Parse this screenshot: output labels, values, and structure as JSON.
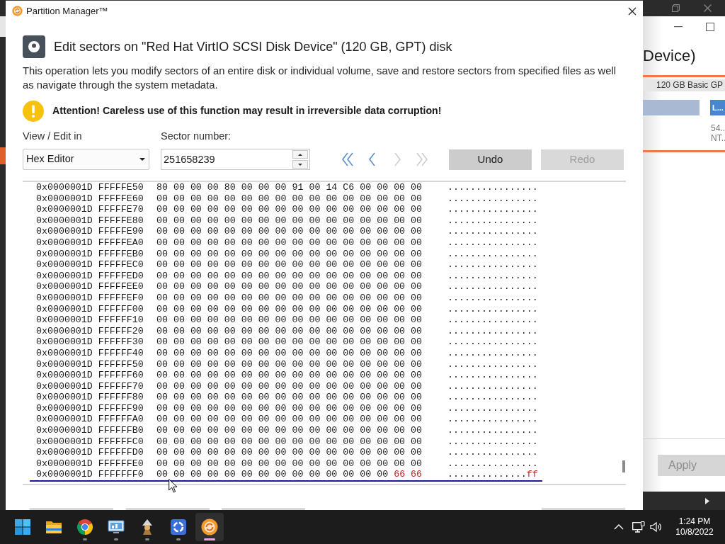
{
  "dialog": {
    "title": "Partition Manager™",
    "heading": "Edit sectors on \"Red Hat VirtIO SCSI Disk Device\" (120 GB, GPT) disk",
    "description": "This operation lets you modify sectors of an entire disk or individual volume, save and restore sectors from specified files as well as navigate through the system metadata.",
    "warning": "Attention! Careless use of this function may result in irreversible data corruption!"
  },
  "view_edit": {
    "label": "View / Edit in",
    "value": "Hex Editor"
  },
  "sector": {
    "label": "Sector number:",
    "value": "251658239"
  },
  "nav_buttons": [
    {
      "kind": "first",
      "disabled": false
    },
    {
      "kind": "previous",
      "disabled": false
    },
    {
      "kind": "next",
      "disabled": true
    },
    {
      "kind": "last",
      "disabled": true
    }
  ],
  "buttons": [
    {
      "label": "Undo",
      "disabled": false
    },
    {
      "label": "Redo",
      "disabled": true
    }
  ],
  "hex_view": {
    "rows": [
      {
        "offset": "0x0000001D FFFFFE50",
        "bytes": [
          "80",
          "00",
          "00",
          "00",
          "80",
          "00",
          "00",
          "00",
          "91",
          "00",
          "14",
          "C6",
          "00",
          "00",
          "00",
          "00"
        ],
        "ascii": "................",
        "editing": false
      },
      {
        "offset": "0x0000001D FFFFFE60",
        "bytes": [
          "00",
          "00",
          "00",
          "00",
          "00",
          "00",
          "00",
          "00",
          "00",
          "00",
          "00",
          "00",
          "00",
          "00",
          "00",
          "00"
        ],
        "ascii": "................",
        "editing": false
      },
      {
        "offset": "0x0000001D FFFFFE70",
        "bytes": [
          "00",
          "00",
          "00",
          "00",
          "00",
          "00",
          "00",
          "00",
          "00",
          "00",
          "00",
          "00",
          "00",
          "00",
          "00",
          "00"
        ],
        "ascii": "................",
        "editing": false
      },
      {
        "offset": "0x0000001D FFFFFE80",
        "bytes": [
          "00",
          "00",
          "00",
          "00",
          "00",
          "00",
          "00",
          "00",
          "00",
          "00",
          "00",
          "00",
          "00",
          "00",
          "00",
          "00"
        ],
        "ascii": "................",
        "editing": false
      },
      {
        "offset": "0x0000001D FFFFFE90",
        "bytes": [
          "00",
          "00",
          "00",
          "00",
          "00",
          "00",
          "00",
          "00",
          "00",
          "00",
          "00",
          "00",
          "00",
          "00",
          "00",
          "00"
        ],
        "ascii": "................",
        "editing": false
      },
      {
        "offset": "0x0000001D FFFFFEA0",
        "bytes": [
          "00",
          "00",
          "00",
          "00",
          "00",
          "00",
          "00",
          "00",
          "00",
          "00",
          "00",
          "00",
          "00",
          "00",
          "00",
          "00"
        ],
        "ascii": "................",
        "editing": false
      },
      {
        "offset": "0x0000001D FFFFFEB0",
        "bytes": [
          "00",
          "00",
          "00",
          "00",
          "00",
          "00",
          "00",
          "00",
          "00",
          "00",
          "00",
          "00",
          "00",
          "00",
          "00",
          "00"
        ],
        "ascii": "................",
        "editing": false
      },
      {
        "offset": "0x0000001D FFFFFEC0",
        "bytes": [
          "00",
          "00",
          "00",
          "00",
          "00",
          "00",
          "00",
          "00",
          "00",
          "00",
          "00",
          "00",
          "00",
          "00",
          "00",
          "00"
        ],
        "ascii": "................",
        "editing": false
      },
      {
        "offset": "0x0000001D FFFFFED0",
        "bytes": [
          "00",
          "00",
          "00",
          "00",
          "00",
          "00",
          "00",
          "00",
          "00",
          "00",
          "00",
          "00",
          "00",
          "00",
          "00",
          "00"
        ],
        "ascii": "................",
        "editing": false
      },
      {
        "offset": "0x0000001D FFFFFEE0",
        "bytes": [
          "00",
          "00",
          "00",
          "00",
          "00",
          "00",
          "00",
          "00",
          "00",
          "00",
          "00",
          "00",
          "00",
          "00",
          "00",
          "00"
        ],
        "ascii": "................",
        "editing": false
      },
      {
        "offset": "0x0000001D FFFFFEF0",
        "bytes": [
          "00",
          "00",
          "00",
          "00",
          "00",
          "00",
          "00",
          "00",
          "00",
          "00",
          "00",
          "00",
          "00",
          "00",
          "00",
          "00"
        ],
        "ascii": "................",
        "editing": false
      },
      {
        "offset": "0x0000001D FFFFFF00",
        "bytes": [
          "00",
          "00",
          "00",
          "00",
          "00",
          "00",
          "00",
          "00",
          "00",
          "00",
          "00",
          "00",
          "00",
          "00",
          "00",
          "00"
        ],
        "ascii": "................",
        "editing": false
      },
      {
        "offset": "0x0000001D FFFFFF10",
        "bytes": [
          "00",
          "00",
          "00",
          "00",
          "00",
          "00",
          "00",
          "00",
          "00",
          "00",
          "00",
          "00",
          "00",
          "00",
          "00",
          "00"
        ],
        "ascii": "................",
        "editing": false
      },
      {
        "offset": "0x0000001D FFFFFF20",
        "bytes": [
          "00",
          "00",
          "00",
          "00",
          "00",
          "00",
          "00",
          "00",
          "00",
          "00",
          "00",
          "00",
          "00",
          "00",
          "00",
          "00"
        ],
        "ascii": "................",
        "editing": false
      },
      {
        "offset": "0x0000001D FFFFFF30",
        "bytes": [
          "00",
          "00",
          "00",
          "00",
          "00",
          "00",
          "00",
          "00",
          "00",
          "00",
          "00",
          "00",
          "00",
          "00",
          "00",
          "00"
        ],
        "ascii": "................",
        "editing": false
      },
      {
        "offset": "0x0000001D FFFFFF40",
        "bytes": [
          "00",
          "00",
          "00",
          "00",
          "00",
          "00",
          "00",
          "00",
          "00",
          "00",
          "00",
          "00",
          "00",
          "00",
          "00",
          "00"
        ],
        "ascii": "................",
        "editing": false
      },
      {
        "offset": "0x0000001D FFFFFF50",
        "bytes": [
          "00",
          "00",
          "00",
          "00",
          "00",
          "00",
          "00",
          "00",
          "00",
          "00",
          "00",
          "00",
          "00",
          "00",
          "00",
          "00"
        ],
        "ascii": "................",
        "editing": false
      },
      {
        "offset": "0x0000001D FFFFFF60",
        "bytes": [
          "00",
          "00",
          "00",
          "00",
          "00",
          "00",
          "00",
          "00",
          "00",
          "00",
          "00",
          "00",
          "00",
          "00",
          "00",
          "00"
        ],
        "ascii": "................",
        "editing": false
      },
      {
        "offset": "0x0000001D FFFFFF70",
        "bytes": [
          "00",
          "00",
          "00",
          "00",
          "00",
          "00",
          "00",
          "00",
          "00",
          "00",
          "00",
          "00",
          "00",
          "00",
          "00",
          "00"
        ],
        "ascii": "................",
        "editing": false
      },
      {
        "offset": "0x0000001D FFFFFF80",
        "bytes": [
          "00",
          "00",
          "00",
          "00",
          "00",
          "00",
          "00",
          "00",
          "00",
          "00",
          "00",
          "00",
          "00",
          "00",
          "00",
          "00"
        ],
        "ascii": "................",
        "editing": false
      },
      {
        "offset": "0x0000001D FFFFFF90",
        "bytes": [
          "00",
          "00",
          "00",
          "00",
          "00",
          "00",
          "00",
          "00",
          "00",
          "00",
          "00",
          "00",
          "00",
          "00",
          "00",
          "00"
        ],
        "ascii": "................",
        "editing": false
      },
      {
        "offset": "0x0000001D FFFFFFA0",
        "bytes": [
          "00",
          "00",
          "00",
          "00",
          "00",
          "00",
          "00",
          "00",
          "00",
          "00",
          "00",
          "00",
          "00",
          "00",
          "00",
          "00"
        ],
        "ascii": "................",
        "editing": false
      },
      {
        "offset": "0x0000001D FFFFFFB0",
        "bytes": [
          "00",
          "00",
          "00",
          "00",
          "00",
          "00",
          "00",
          "00",
          "00",
          "00",
          "00",
          "00",
          "00",
          "00",
          "00",
          "00"
        ],
        "ascii": "................",
        "editing": false
      },
      {
        "offset": "0x0000001D FFFFFFC0",
        "bytes": [
          "00",
          "00",
          "00",
          "00",
          "00",
          "00",
          "00",
          "00",
          "00",
          "00",
          "00",
          "00",
          "00",
          "00",
          "00",
          "00"
        ],
        "ascii": "................",
        "editing": false
      },
      {
        "offset": "0x0000001D FFFFFFD0",
        "bytes": [
          "00",
          "00",
          "00",
          "00",
          "00",
          "00",
          "00",
          "00",
          "00",
          "00",
          "00",
          "00",
          "00",
          "00",
          "00",
          "00"
        ],
        "ascii": "................",
        "editing": false
      },
      {
        "offset": "0x0000001D FFFFFFE0",
        "bytes": [
          "00",
          "00",
          "00",
          "00",
          "00",
          "00",
          "00",
          "00",
          "00",
          "00",
          "00",
          "00",
          "00",
          "00",
          "00",
          "00"
        ],
        "ascii": "................",
        "editing": false
      },
      {
        "offset": "0x0000001D FFFFFFF0",
        "bytes": [
          "00",
          "00",
          "00",
          "00",
          "00",
          "00",
          "00",
          "00",
          "00",
          "00",
          "00",
          "00",
          "00",
          "00"
        ],
        "modified_bytes": [
          "66",
          "66"
        ],
        "ascii": "..............",
        "modified_ascii": "ff",
        "editing": true
      }
    ]
  },
  "background_window": {
    "heading": "Device)",
    "disk_label": "120 GB Basic GP",
    "partition_label": "L...",
    "partition_size": "54..",
    "partition_fs": "NT..",
    "apply_button": {
      "label": "Apply",
      "disabled": true
    }
  },
  "taskbar": {
    "apps": [
      {
        "kind": "start",
        "running": false,
        "selected": false
      },
      {
        "kind": "folder",
        "running": false,
        "selected": false
      },
      {
        "kind": "wheel",
        "running": true,
        "selected": false
      },
      {
        "kind": "monitor",
        "running": true,
        "selected": false
      },
      {
        "kind": "figure",
        "running": true,
        "selected": false
      },
      {
        "kind": "ring",
        "running": true,
        "selected": false
      },
      {
        "kind": "swirl",
        "running": true,
        "selected": true
      }
    ],
    "time": "1:24 PM",
    "date": "10/8/2022"
  }
}
